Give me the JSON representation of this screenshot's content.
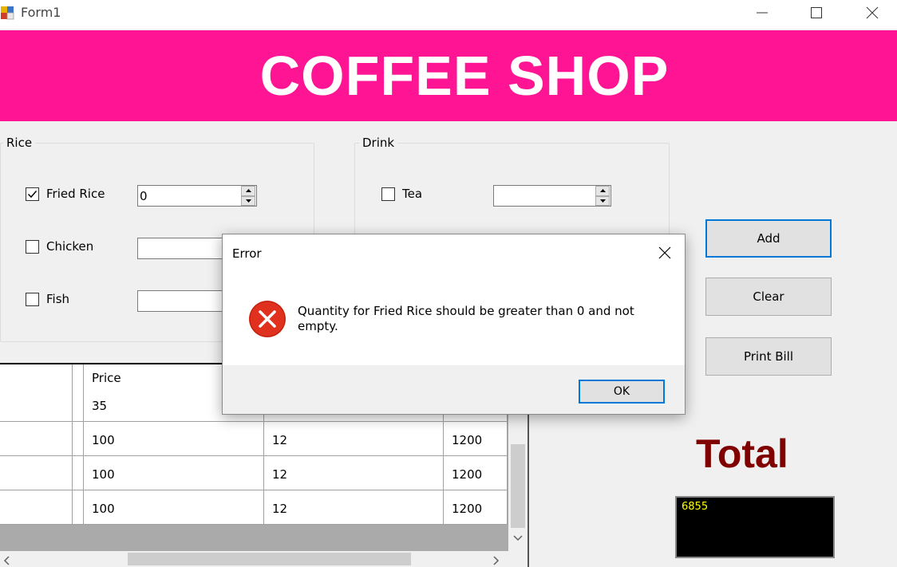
{
  "window": {
    "title": "Form1"
  },
  "header": {
    "title": "COFFEE SHOP",
    "color": "#ff1493"
  },
  "rice_group": {
    "label": "Rice",
    "items": [
      {
        "label": "Fried Rice",
        "checked": true,
        "value": "0"
      },
      {
        "label": "Chicken",
        "checked": false,
        "value": ""
      },
      {
        "label": "Fish",
        "checked": false,
        "value": ""
      }
    ]
  },
  "drink_group": {
    "label": "Drink",
    "items": [
      {
        "label": "Tea",
        "checked": false,
        "value": ""
      }
    ]
  },
  "buttons": {
    "add": "Add",
    "clear": "Clear",
    "print": "Print Bill"
  },
  "grid": {
    "header": [
      "",
      "Price"
    ],
    "rows": [
      [
        "",
        "35",
        "",
        ""
      ],
      [
        "",
        "100",
        "12",
        "1200"
      ],
      [
        "",
        "100",
        "12",
        "1200"
      ],
      [
        "",
        "100",
        "12",
        "1200"
      ]
    ]
  },
  "total": {
    "label": "Total",
    "value": "6855",
    "label_color": "#800000"
  },
  "dialog": {
    "title": "Error",
    "message": "Quantity for Fried Rice should be greater than 0 and not empty.",
    "ok": "OK",
    "icon": "error-icon"
  }
}
